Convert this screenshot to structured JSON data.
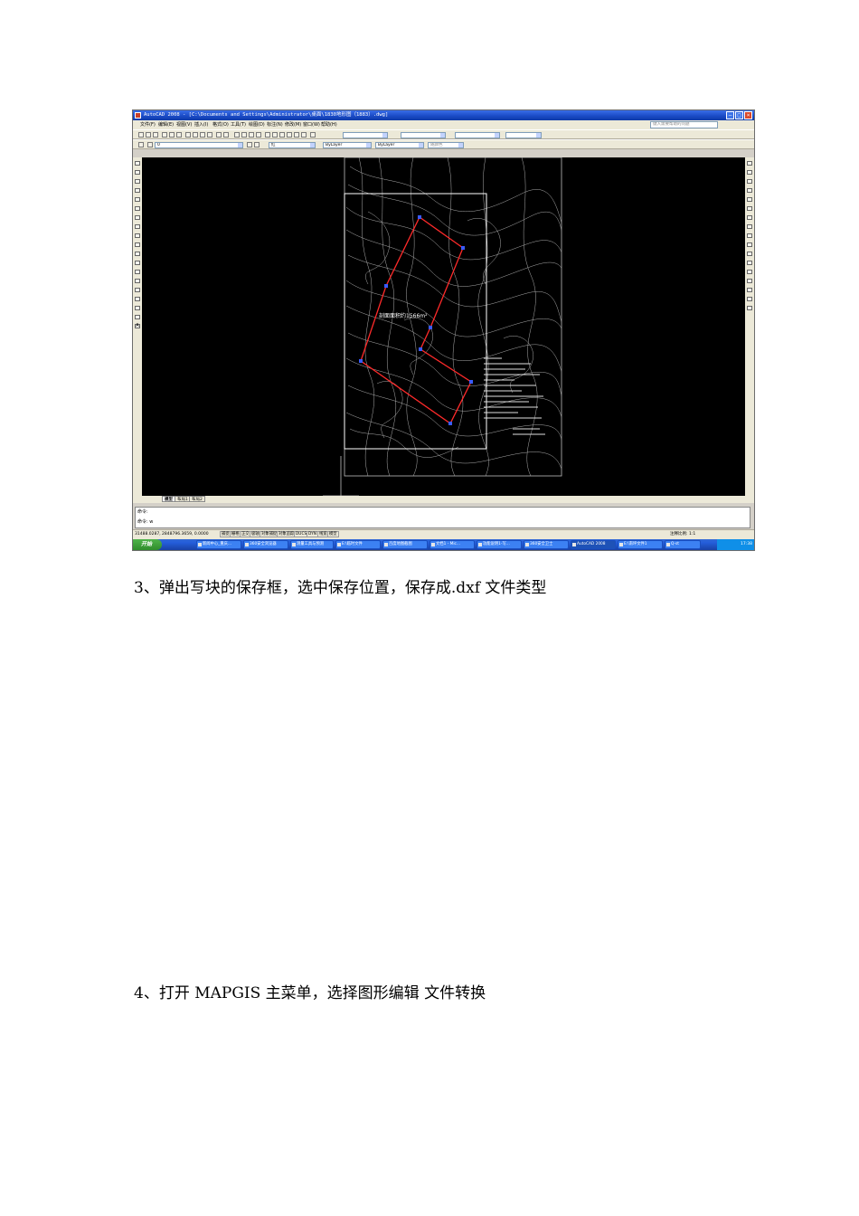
{
  "screenshot": {
    "window_title": "AutoCAD 2008 - [C:\\Documents and Settings\\Administrator\\桌面\\1830地形图（1883）.dwg]",
    "menu": [
      "文件(F)",
      "编辑(E)",
      "视图(V)",
      "插入(I)",
      "格式(O)",
      "工具(T)",
      "绘图(D)",
      "标注(N)",
      "修改(M)",
      "窗口(W)",
      "帮助(H)"
    ],
    "help_search_placeholder": "键入需要帮助的问题",
    "layer_combo": "0",
    "color_combo": "红",
    "linetype_combo": "ByLayer",
    "lineweight_combo": "ByLayer",
    "plotstyle_combo": "随颜色",
    "area_label": "剖面面积约1566m²",
    "layout_tabs": [
      "模型",
      "布局1",
      "布局2"
    ],
    "command_lines": [
      "命令:",
      "命令: w"
    ],
    "status_coords": "31488.0287, 2848796.3659, 0.0000",
    "status_buttons": [
      "捕捉",
      "栅格",
      "正交",
      "极轴",
      "对象捕捉",
      "对象追踪",
      "DUCS",
      "DYN",
      "线宽",
      "模型"
    ],
    "annotation_scale": "注释比例: 1:1",
    "start_button": "开始",
    "taskbar_items": [
      "新闻中心_重庆...",
      "360安全浏览器",
      "测量工具与预测",
      "E:\\临时文件",
      "百度地图截图",
      "文档1 - Mic...",
      "功能说明1-写...",
      "360安全卫士",
      "AutoCAD 2008",
      "E:\\南坪文件1",
      "Q-st"
    ],
    "clock": "17:38"
  },
  "doc": {
    "step3": "3、弹出写块的保存框，选中保存位置，保存成.dxf 文件类型",
    "step4": "4、打开 MAPGIS 主菜单，选择图形编辑  文件转换"
  },
  "colors": {
    "model_space": "#000000",
    "boundary": "#ff2a2a",
    "vertex": "#3a5bff",
    "contours": "#cfcfcf"
  }
}
